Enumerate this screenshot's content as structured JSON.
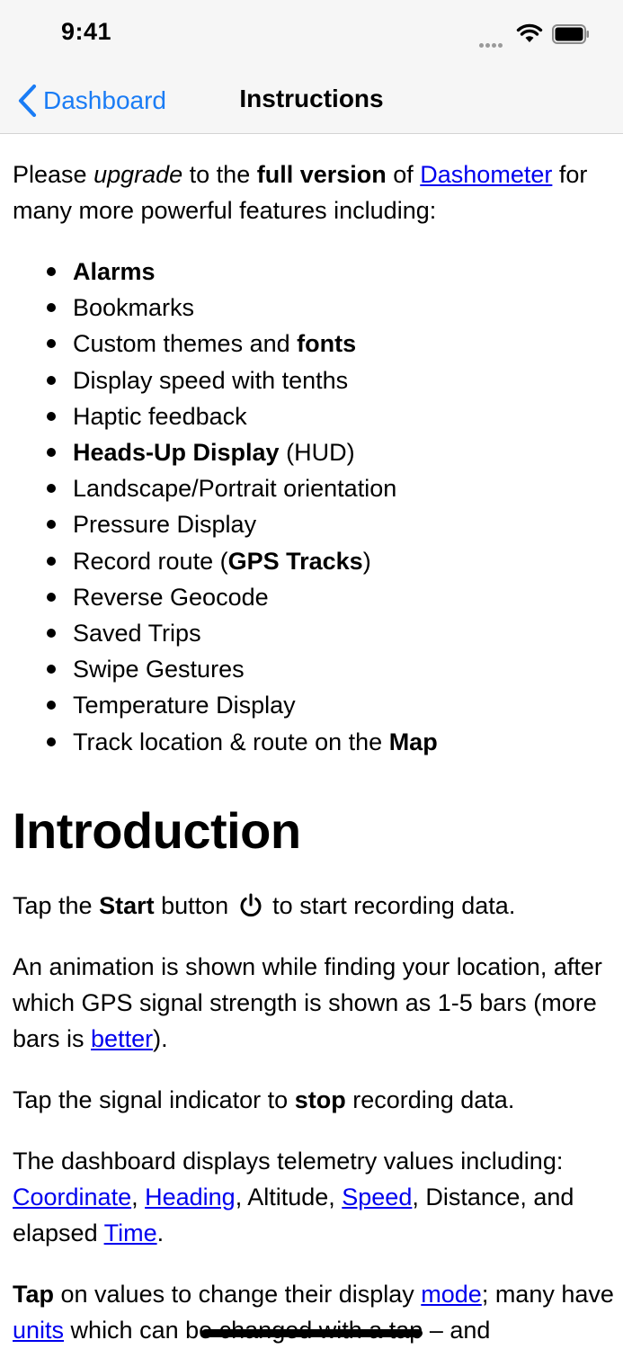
{
  "status_bar": {
    "time": "9:41"
  },
  "nav": {
    "back_label": "Dashboard",
    "title": "Instructions"
  },
  "upgrade": {
    "pre": "Please ",
    "em": "upgrade",
    "mid1": " to the ",
    "bold": "full version",
    "mid2": " of ",
    "link": "Dashometer",
    "post": " for many more powerful features including:"
  },
  "features": [
    {
      "bold_pre": "Alarms",
      "text": "",
      "bold_post": "",
      "tail": ""
    },
    {
      "bold_pre": "",
      "text": "Bookmarks",
      "bold_post": "",
      "tail": ""
    },
    {
      "bold_pre": "",
      "text": "Custom themes and ",
      "bold_post": "fonts",
      "tail": ""
    },
    {
      "bold_pre": "",
      "text": "Display speed with tenths",
      "bold_post": "",
      "tail": ""
    },
    {
      "bold_pre": "",
      "text": "Haptic feedback",
      "bold_post": "",
      "tail": ""
    },
    {
      "bold_pre": "Heads-Up Display",
      "text": " (HUD)",
      "bold_post": "",
      "tail": ""
    },
    {
      "bold_pre": "",
      "text": "Landscape/Portrait orientation",
      "bold_post": "",
      "tail": ""
    },
    {
      "bold_pre": "",
      "text": "Pressure Display",
      "bold_post": "",
      "tail": ""
    },
    {
      "bold_pre": "",
      "text": "Record route (",
      "bold_post": "GPS Tracks",
      "tail": ")"
    },
    {
      "bold_pre": "",
      "text": "Reverse Geocode",
      "bold_post": "",
      "tail": ""
    },
    {
      "bold_pre": "",
      "text": "Saved Trips",
      "bold_post": "",
      "tail": ""
    },
    {
      "bold_pre": "",
      "text": "Swipe Gestures",
      "bold_post": "",
      "tail": ""
    },
    {
      "bold_pre": "",
      "text": "Temperature Display",
      "bold_post": "",
      "tail": ""
    },
    {
      "bold_pre": "",
      "text": "Track location & route on the ",
      "bold_post": "Map",
      "tail": ""
    }
  ],
  "intro": {
    "heading": "Introduction",
    "p1": {
      "pre": "Tap the ",
      "bold": "Start",
      "mid": " button ",
      "post": " to start recording data."
    },
    "p2": {
      "pre": "An animation is shown while finding your location, after which GPS signal strength is shown as 1-5 bars (more bars is ",
      "link": "better",
      "post": ")."
    },
    "p3": {
      "pre": "Tap the signal indicator to ",
      "bold": "stop",
      "post": " recording data."
    },
    "p4": {
      "pre": "The dashboard displays telemetry values including: ",
      "link1": "Coordinate",
      "sep1": ", ",
      "link2": "Heading",
      "sep2": ", Altitude, ",
      "link3": "Speed",
      "sep3": ", Distance, and elapsed ",
      "link4": "Time",
      "post": "."
    },
    "p5": {
      "bold": "Tap",
      "pre": " on values to change their display ",
      "link1": "mode",
      "mid": "; many have ",
      "link2": "units",
      "post": " which can be changed with a tap – and"
    }
  }
}
